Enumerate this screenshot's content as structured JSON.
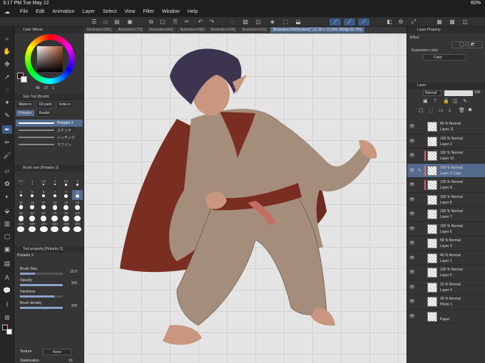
{
  "status": {
    "time": "3:17 PM",
    "date": "Tue May 12",
    "battery": "60%"
  },
  "menu": [
    "File",
    "Edit",
    "Animation",
    "Layer",
    "Select",
    "View",
    "Filter",
    "Window",
    "Help"
  ],
  "tabs": [
    {
      "label": "Illustration180()",
      "active": false
    },
    {
      "label": "Illustration170()",
      "active": false
    },
    {
      "label": "Illustration184()",
      "active": false
    },
    {
      "label": "Illustration188()",
      "active": false
    },
    {
      "label": "Illustration168()",
      "active": false
    },
    {
      "label": "Illustration193()",
      "active": false
    },
    {
      "label": "Illustration194(Restore)* (11.50 x 13.00in 350dpi 62.4%)",
      "active": true
    }
  ],
  "color_wheel": {
    "title": "Color Wheel",
    "r": "49",
    "g": "17",
    "b": "1",
    "fg": "#2a0e0a",
    "bg": "#ffffff"
  },
  "sub_tool": {
    "title": "Sub Tool [Brush]",
    "tabs": [
      "Waterco",
      "Oil paint",
      "India in"
    ],
    "tabs2": [
      "Pintador",
      "Realist"
    ],
    "brushes": [
      {
        "label": "Pintador 2",
        "on": true
      },
      {
        "label": "スケッチ",
        "on": false
      },
      {
        "label": "ハッチング",
        "on": false
      },
      {
        "label": "ラフペン",
        "on": false
      }
    ]
  },
  "brush_size": {
    "title": "Brush size [Pintador 2]",
    "sizes": [
      "0.7",
      "1",
      "1.5",
      "2",
      "2.5",
      "3",
      "4",
      "5",
      "6",
      "7",
      "8",
      "10",
      "12",
      "15",
      "17",
      "20",
      "25",
      "30",
      "40",
      "50",
      "60",
      "70",
      "80",
      "100",
      "120",
      "150",
      "170",
      "200",
      "250",
      "300"
    ],
    "selected": "10"
  },
  "tool_property": {
    "title": "Tool property [Pintador 2]",
    "name": "Pintador 2",
    "rows": [
      {
        "label": "Brush Size",
        "value": "10.0",
        "fill": 0.35
      },
      {
        "label": "Opacity",
        "value": "100",
        "fill": 1.0
      },
      {
        "label": "Hardness",
        "value": "",
        "fill": 0.8
      },
      {
        "label": "Brush density",
        "value": "100",
        "fill": 1.0
      }
    ],
    "texture_label": "Texture",
    "texture_value": "None",
    "stabilization_label": "Stabilization",
    "stabilization_value": "10"
  },
  "layer_property": {
    "title": "Layer Property",
    "effect": "Effect",
    "expression_label": "Expression color",
    "expression_value": "Color"
  },
  "layer_panel": {
    "title": "Layer",
    "blend": "Normal",
    "opacity": "100",
    "opacity_fill": 1.0,
    "layers": [
      {
        "line1": "66 % Normal",
        "line2": "Layer 11",
        "selected": false,
        "marked": false
      },
      {
        "line1": "100 % Normal",
        "line2": "Layer 2",
        "selected": false,
        "marked": false
      },
      {
        "line1": "100 % Normal",
        "line2": "Layer 10",
        "selected": false,
        "marked": true
      },
      {
        "line1": "100 % Normal",
        "line2": "Layer 9 Copy",
        "selected": true,
        "marked": true
      },
      {
        "line1": "100 % Normal",
        "line2": "Layer 9",
        "selected": false,
        "marked": true
      },
      {
        "line1": "100 % Normal",
        "line2": "Layer 8",
        "selected": false,
        "marked": false
      },
      {
        "line1": "100 % Normal",
        "line2": "Layer 7",
        "selected": false,
        "marked": false
      },
      {
        "line1": "100 % Normal",
        "line2": "Layer 6",
        "selected": false,
        "marked": false
      },
      {
        "line1": "58 % Normal",
        "line2": "Layer 3",
        "selected": false,
        "marked": false
      },
      {
        "line1": "46 % Normal",
        "line2": "Layer 1",
        "selected": false,
        "marked": false
      },
      {
        "line1": "100 % Normal",
        "line2": "Layer 5",
        "selected": false,
        "marked": false
      },
      {
        "line1": "15 % Normal",
        "line2": "Layer 4",
        "selected": false,
        "marked": false
      },
      {
        "line1": "39 % Normal",
        "line2": "Photo 1",
        "selected": false,
        "marked": false
      },
      {
        "line1": "",
        "line2": "Paper",
        "selected": false,
        "marked": false
      }
    ]
  }
}
